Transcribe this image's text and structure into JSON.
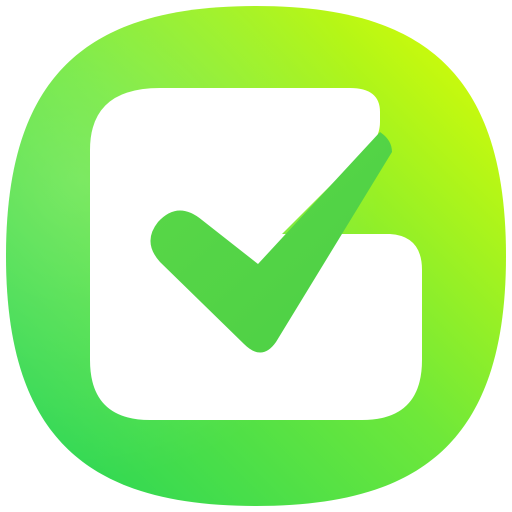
{
  "app_icon": {
    "icon_name": "checkbox-checked-icon",
    "colors": {
      "gradient_top_right": "#e2ff00",
      "gradient_mid": "#6ee83a",
      "gradient_bottom_left": "#22d45a",
      "check_mark": "#5ad848",
      "box_fill": "#ffffff"
    }
  }
}
